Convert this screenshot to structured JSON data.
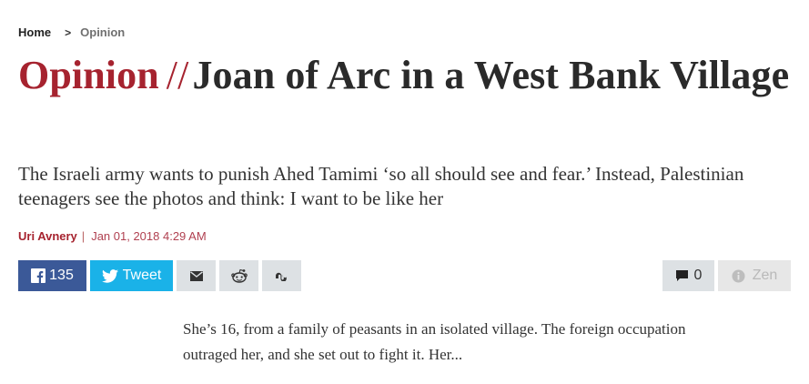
{
  "breadcrumb": {
    "home": "Home",
    "separator": ">",
    "current": "Opinion"
  },
  "headline": {
    "section": "Opinion",
    "slashes": "//",
    "title": "Joan of Arc in a West Bank Village"
  },
  "subhead": "The Israeli army wants to punish Ahed Tamimi ‘so all should see and fear.’ Instead, Palestinian teenagers see the photos and think: I want to be like her",
  "byline": {
    "author": "Uri Avnery",
    "pipe": "|",
    "date": "Jan 01, 2018 4:29 AM"
  },
  "share": {
    "facebook_count": "135",
    "twitter_label": "Tweet",
    "icons": [
      "facebook-icon",
      "twitter-icon",
      "email-icon",
      "reddit-icon",
      "stumbleupon-icon"
    ]
  },
  "tools": {
    "comments_count": "0",
    "zen_label": "Zen"
  },
  "colors": {
    "accent": "#a6232f",
    "facebook": "#3b5998",
    "twitter": "#1ab2e8",
    "button_gray": "#dde1e4"
  },
  "article": {
    "excerpt": "She’s 16, from a family of peasants in an isolated village. The foreign occupation outraged her, and she set out to fight it. Her..."
  }
}
